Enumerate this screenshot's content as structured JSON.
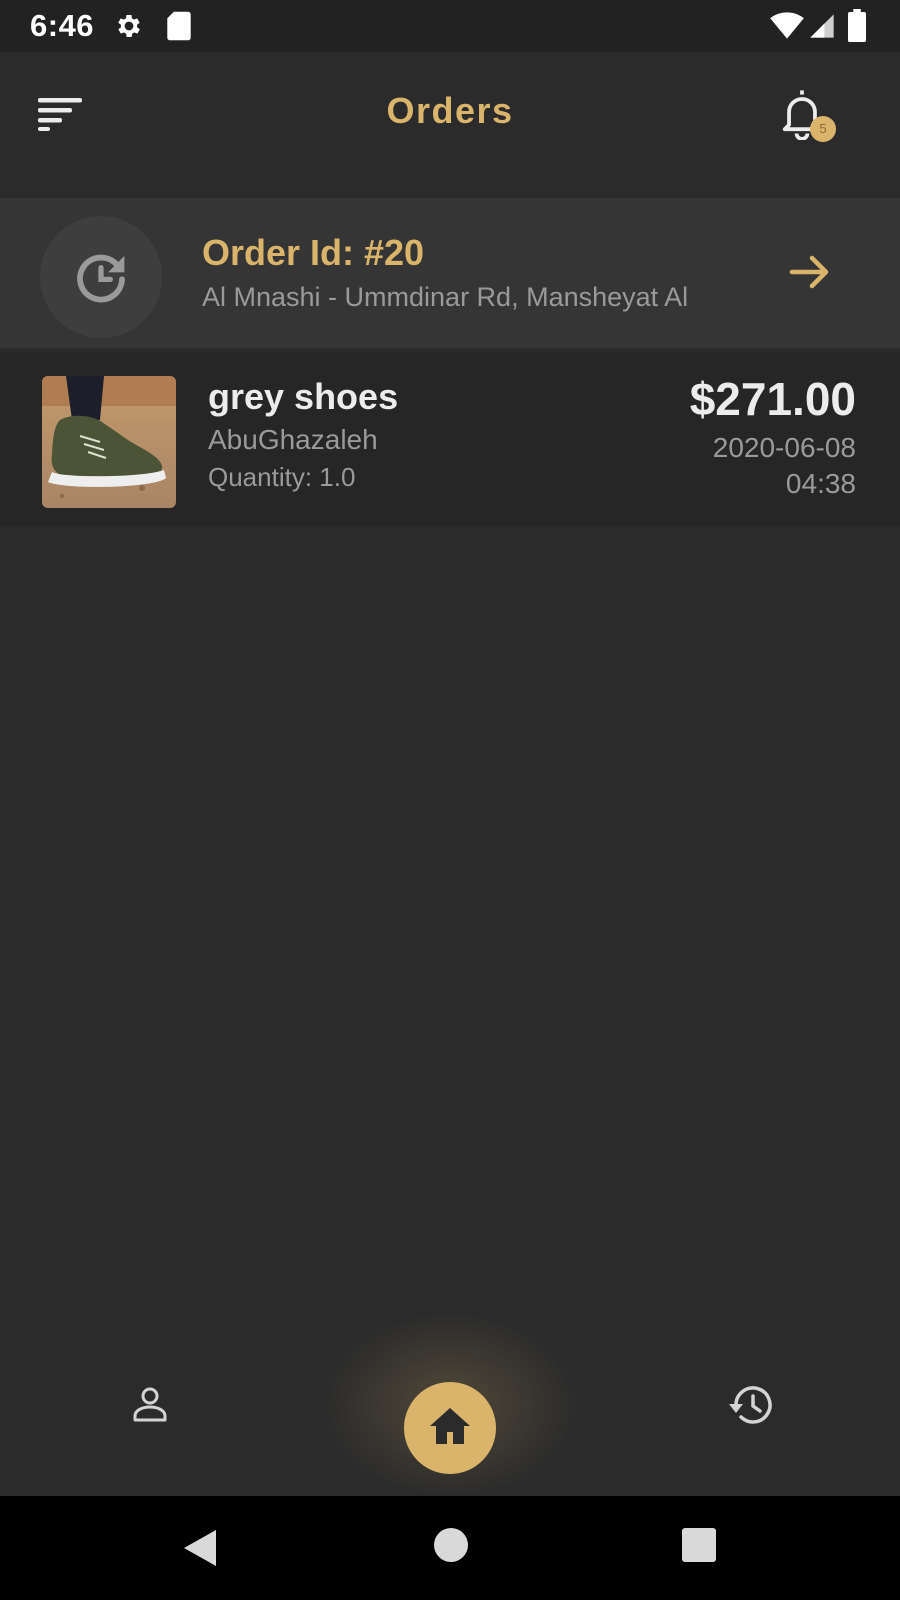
{
  "status_bar": {
    "time": "6:46",
    "icons": [
      "gear-icon",
      "sd-card-icon",
      "wifi-icon",
      "signal-icon",
      "battery-icon"
    ]
  },
  "app_bar": {
    "title": "Orders",
    "menu_icon": "sort-menu-icon",
    "notification_icon": "bell-icon",
    "notification_count": "5"
  },
  "order": {
    "icon": "history-refresh-icon",
    "id_label": "Order Id: #20",
    "address": "Al Mnashi - Ummdinar Rd, Mansheyat Al",
    "arrow_icon": "arrow-right-icon"
  },
  "items": [
    {
      "name": "grey shoes",
      "store": "AbuGhazaleh",
      "quantity": "Quantity: 1.0",
      "price": "$271.00",
      "date": "2020-06-08",
      "time": "04:38",
      "image": "shoe-photo"
    }
  ],
  "bottom_nav": {
    "items": [
      "profile-icon",
      "home-icon",
      "history-icon"
    ],
    "active": "home-icon"
  },
  "system_nav": [
    "back-icon",
    "home-circle-icon",
    "recents-icon"
  ],
  "colors": {
    "accent": "#d9b46a",
    "background": "#2b2b2b",
    "card": "#353535",
    "text_primary": "#ececec",
    "text_secondary": "#9a9a9a"
  }
}
